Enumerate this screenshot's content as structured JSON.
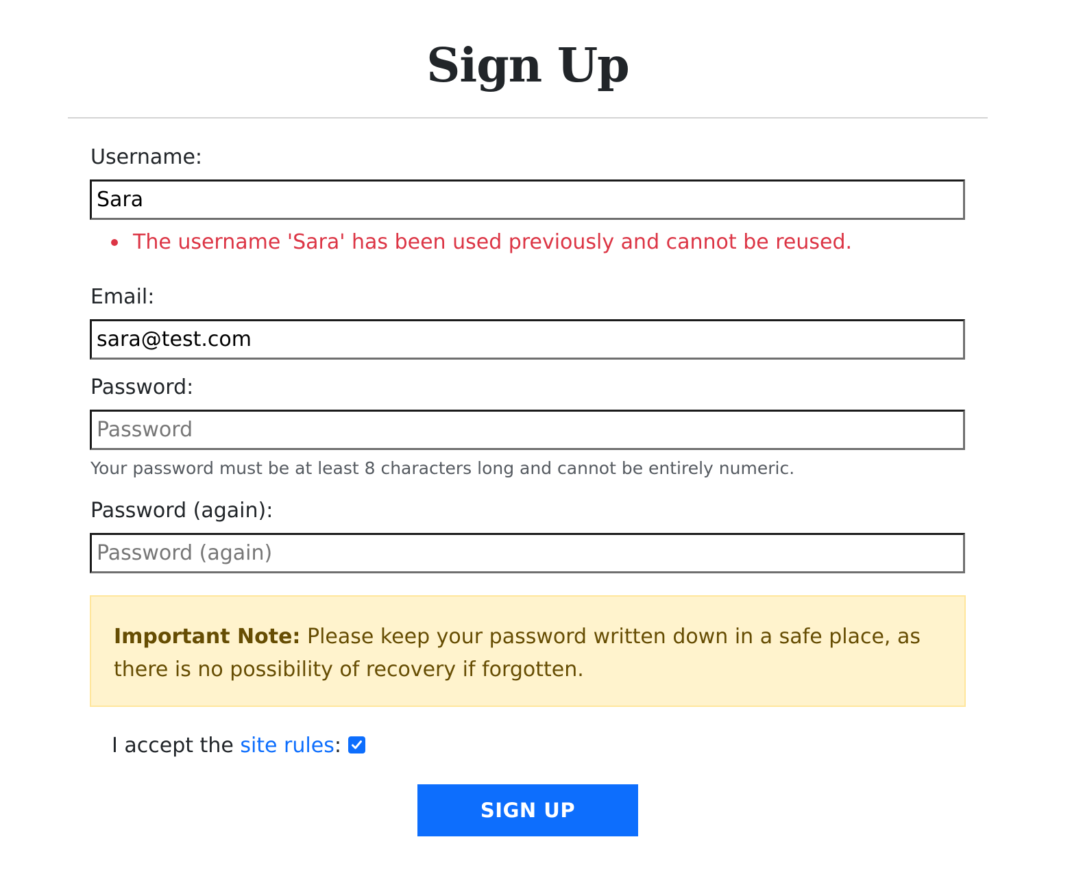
{
  "page": {
    "title": "Sign Up"
  },
  "form": {
    "username": {
      "label": "Username:",
      "value": "Sara",
      "errors": [
        "The username 'Sara' has been used previously and cannot be reused."
      ]
    },
    "email": {
      "label": "Email:",
      "value": "sara@test.com"
    },
    "password": {
      "label": "Password:",
      "placeholder": "Password",
      "help": "Your password must be at least 8 characters long and cannot be entirely numeric."
    },
    "password_again": {
      "label": "Password (again):",
      "placeholder": "Password (again)"
    },
    "note": {
      "heading": "Important Note:",
      "text": " Please keep your password written down in a safe place, as there is no possibility of recovery if forgotten."
    },
    "accept": {
      "prefix": "I accept the ",
      "link_text": "site rules",
      "suffix": ":",
      "checked": true
    },
    "submit_label": "SIGN UP"
  },
  "colors": {
    "primary": "#0d6efd",
    "error": "#dc3545",
    "alert_background": "#fff3cd",
    "alert_text": "#664d03"
  }
}
